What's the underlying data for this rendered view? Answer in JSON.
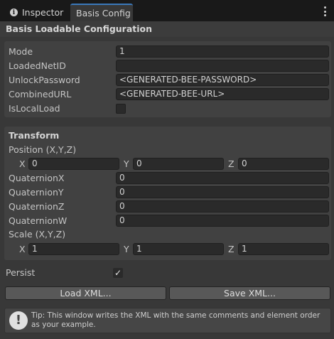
{
  "tabs": [
    {
      "label": "Inspector",
      "icon": "info-icon"
    },
    {
      "label": "Basis Config"
    }
  ],
  "header": {
    "title": "Basis Loadable Configuration"
  },
  "config": {
    "mode_label": "Mode",
    "mode_value": "1",
    "netid_label": "LoadedNetID",
    "netid_value": "",
    "password_label": "UnlockPassword",
    "password_value": "<GENERATED-BEE-PASSWORD>",
    "url_label": "CombinedURL",
    "url_value": "<GENERATED-BEE-URL>",
    "local_label": "IsLocalLoad",
    "local_checked": false
  },
  "transform": {
    "title": "Transform",
    "position_label": "Position (X,Y,Z)",
    "position": {
      "x_label": "X",
      "x": "0",
      "y_label": "Y",
      "y": "0",
      "z_label": "Z",
      "z": "0"
    },
    "qx_label": "QuaternionX",
    "qx": "0",
    "qy_label": "QuaternionY",
    "qy": "0",
    "qz_label": "QuaternionZ",
    "qz": "0",
    "qw_label": "QuaternionW",
    "qw": "0",
    "scale_label": "Scale (X,Y,Z)",
    "scale": {
      "x_label": "X",
      "x": "1",
      "y_label": "Y",
      "y": "1",
      "z_label": "Z",
      "z": "1"
    }
  },
  "persist": {
    "label": "Persist",
    "checked": true,
    "check_glyph": "✓"
  },
  "buttons": {
    "load": "Load XML...",
    "save": "Save XML..."
  },
  "help": {
    "icon_glyph": "!",
    "text": "Tip: This window writes the XML with the same comments and element order as your example."
  },
  "colors": {
    "tab_accent": "#3a79bb",
    "panel_bg": "#383838",
    "field_bg": "#2a2a2a"
  }
}
